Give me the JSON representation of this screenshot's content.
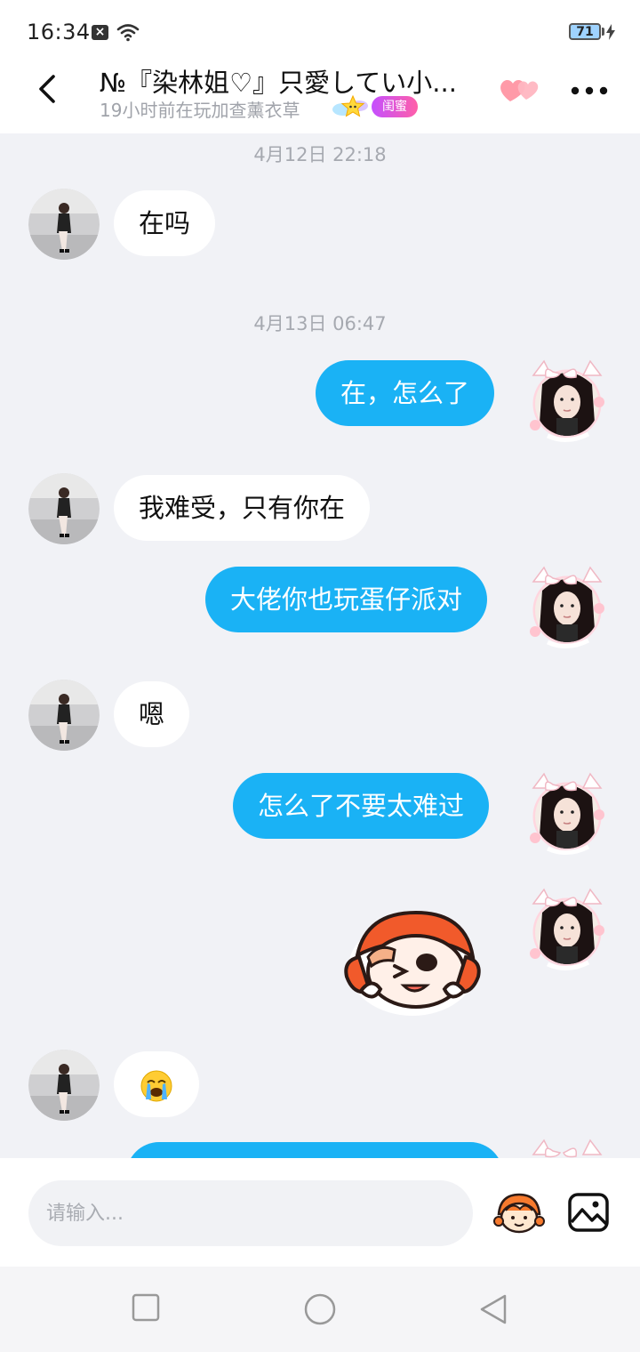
{
  "status_bar": {
    "time": "16:34",
    "notification_icon": "x-icon",
    "battery_level": "71",
    "charging": true
  },
  "header": {
    "title": "№『染林姐♡』只愛してい小...",
    "subtitle": "19小时前在玩加查薰衣草",
    "badge_label": "闺蜜",
    "icons": [
      "back-icon",
      "star-icon",
      "hearts-icon",
      "more-icon"
    ]
  },
  "conversation": {
    "timestamps": [
      "4月12日 22:18",
      "4月13日 06:47"
    ],
    "messages": [
      {
        "sender": "other",
        "type": "text",
        "text": "在吗"
      },
      {
        "sender": "me",
        "type": "text",
        "text": "在，怎么了"
      },
      {
        "sender": "other",
        "type": "text",
        "text": "我难受，只有你在"
      },
      {
        "sender": "me",
        "type": "text",
        "text": "大佬你也玩蛋仔派对"
      },
      {
        "sender": "other",
        "type": "text",
        "text": "嗯"
      },
      {
        "sender": "me",
        "type": "text",
        "text": "怎么了不要太难过"
      },
      {
        "sender": "me",
        "type": "sticker",
        "sticker": "eggy-character-sticker"
      },
      {
        "sender": "other",
        "type": "emoji",
        "emoji": "😭"
      }
    ]
  },
  "input_bar": {
    "placeholder": "请输入...",
    "icons": [
      "eggy-sticker-icon",
      "image-icon"
    ]
  },
  "nav_bar": {
    "icons": [
      "recent-apps-icon",
      "home-icon",
      "back-nav-icon"
    ]
  },
  "colors": {
    "outgoing_bubble": "#1ab2f5",
    "incoming_bubble": "#ffffff",
    "chat_background": "#f1f2f6",
    "badge_gradient": [
      "#c44fff",
      "#ff5fa8"
    ]
  }
}
